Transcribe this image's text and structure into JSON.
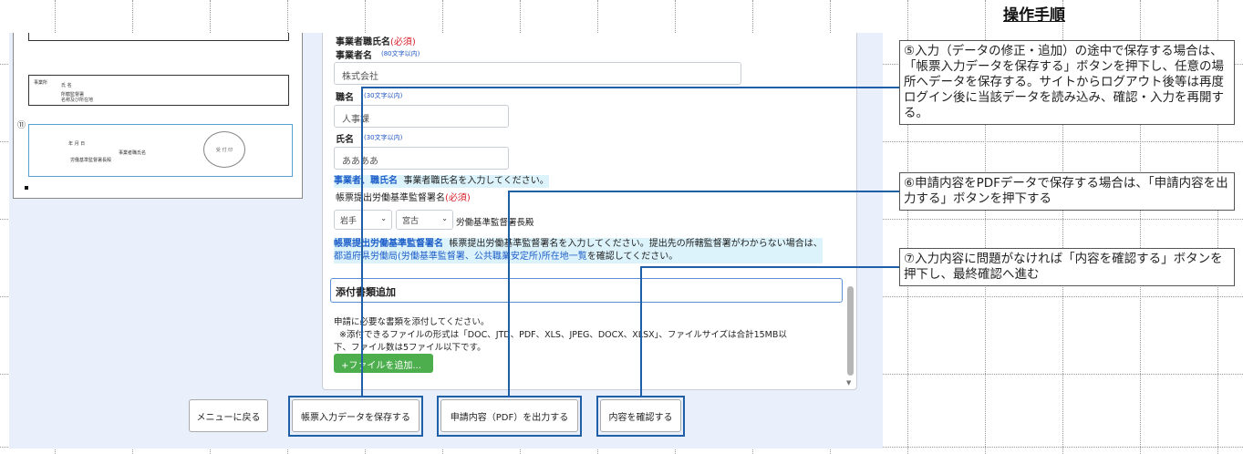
{
  "header": {
    "title": "操作手順"
  },
  "preview": {
    "circle_number": "⑪",
    "row_label_a": "事業所",
    "row_label_b": "氏  名",
    "row_small_a": "所轄監督署",
    "row_small_b": "名称及び所在地",
    "date_line": "年  月  日",
    "employer_label": "事業者職氏名",
    "director_line": "労働基準監督署長殿",
    "stamp_text": "受 付 印"
  },
  "form": {
    "section_title": "事業者職氏名",
    "required_mark": "(必須)",
    "company_label": "事業者名",
    "company_hint": "(80文字以内)",
    "company_value": "株式会社",
    "position_label": "職名",
    "position_hint": "(30文字以内)",
    "position_value": "人事課",
    "name_label": "氏名",
    "name_hint": "(30文字以内)",
    "name_value": "ああああ",
    "note1_highlight": "事業者、職氏名",
    "note1_text": "事業者職氏名を入力してください。",
    "office_label": "帳票提出労働基準監督署名",
    "office_required": "(必須)",
    "prefecture_value": "岩手",
    "office_value": "宮古",
    "office_suffix": "労働基準監督署長殿",
    "note2_highlight": "帳票提出労働基準監督署名",
    "note2_text": "帳票提出労働基準監督署名を入力してください。提出先の所轄監督署がわからない場合は、",
    "note2_link": "都道府県労働局(労働基準監督署、公共職業安定所)所在地一覧",
    "note2_tail": "を確認してください。",
    "attach_title": "添付書類追加",
    "attach_line1": "申請に必要な書類を添付してください。",
    "attach_line2": "※添付できるファイルの形式は「DOC、JTD、PDF、XLS、JPEG、DOCX、XLSX」、ファイルサイズは合計15MB以",
    "attach_line3": "下、ファイル数は5ファイル以下です。",
    "add_file_label": "+ファイルを追加..."
  },
  "buttons": {
    "back": "メニューに戻る",
    "save": "帳票入力データを保存する",
    "output_pdf": "申請内容（PDF）を出力する",
    "confirm": "内容を確認する"
  },
  "callouts": [
    {
      "text": "⑤入力（データの修正・追加）の途中で保存する場合は、「帳票入力データを保存する」ボタンを押下し、任意の場所へデータを保存する。サイトからログアウト後等は再度ログイン後に当該データを読み込み、確認・入力を再開する。"
    },
    {
      "text": "⑥申請内容をPDFデータで保存する場合は、「申請内容を出力する」ボタンを押下する"
    },
    {
      "text": "⑦入力内容に問題がなければ「内容を確認する」ボタンを押下し、最終確認へ進む"
    }
  ],
  "colors": {
    "accent": "#1f5fa8",
    "required": "#d9202a",
    "add_button": "#4cae4c",
    "note_bg": "#dcf3fb"
  }
}
